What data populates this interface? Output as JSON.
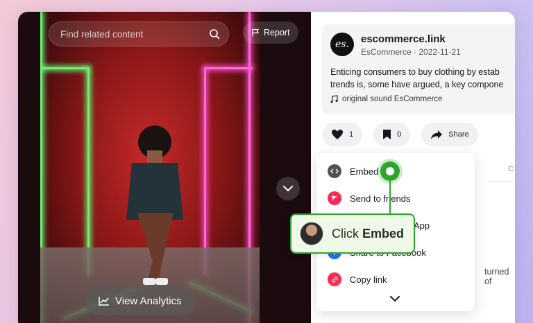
{
  "video": {
    "search_placeholder": "Find related content",
    "report_label": "Report",
    "analytics_label": "View Analytics"
  },
  "post": {
    "avatar_text": "es.",
    "handle": "escommerce.link",
    "meta": "EsCommerce · 2022-11-21",
    "description_line1": "Enticing consumers to buy clothing by estab",
    "description_line2": "trends is, some have argued, a key compone",
    "sound": "original sound EsCommerce"
  },
  "actions": {
    "likes": "1",
    "saves": "0",
    "share_label": "Share"
  },
  "background_fragments": {
    "tab_letter": "C",
    "overlap_prefix": "App",
    "trailing_text": "turned of"
  },
  "share_menu": {
    "items": [
      {
        "label": "Embed",
        "icon": "code-icon",
        "color": "#505058"
      },
      {
        "label": "Send to friends",
        "icon": "send-icon",
        "color": "#fe2c55"
      },
      {
        "label": "Share to Facebook",
        "icon": "facebook-icon",
        "color": "#1877f2"
      },
      {
        "label": "Copy link",
        "icon": "link-icon",
        "color": "#fe2c55"
      }
    ]
  },
  "callout": {
    "prefix": "Click",
    "action": "Embed"
  },
  "colors": {
    "accent_green": "#2ea52a"
  }
}
